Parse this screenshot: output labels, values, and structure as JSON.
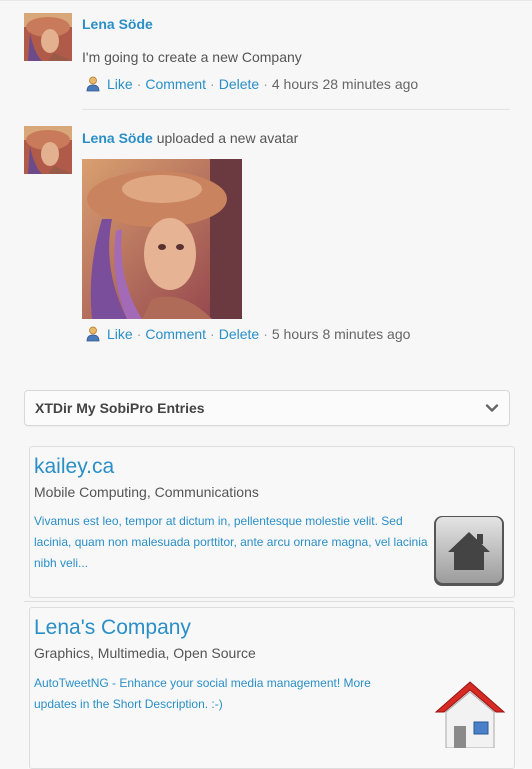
{
  "activity": [
    {
      "user": "Lena Söde",
      "message": "I'm going to create a new Company",
      "like": "Like",
      "comment": "Comment",
      "delete": "Delete",
      "time": "4 hours 28 minutes ago"
    },
    {
      "user": "Lena Söde",
      "action": "uploaded a new avatar",
      "like": "Like",
      "comment": "Comment",
      "delete": "Delete",
      "time": "5 hours 8 minutes ago"
    }
  ],
  "separator": "·",
  "module": {
    "title": "XTDir My SobiPro Entries",
    "toggle_icon": "chevron-down-icon"
  },
  "entries": [
    {
      "title": "kailey.ca",
      "categories": "Mobile Computing, Communications",
      "description": "Vivamus est leo, tempor at dictum in, pellentesque molestie velit. Sed lacinia, quam non malesuada porttitor, ante arcu ornare magna, vel lacinia nibh veli...",
      "icon": "home-icon-gray"
    },
    {
      "title": "Lena's Company",
      "categories": "Graphics, Multimedia, Open Source",
      "description": "AutoTweetNG - Enhance your social media management! More updates in the Short Description. :-)",
      "icon": "home-icon-red"
    }
  ],
  "colors": {
    "link": "#2a8fc7",
    "text": "#555555",
    "background": "#f7f7f7"
  }
}
